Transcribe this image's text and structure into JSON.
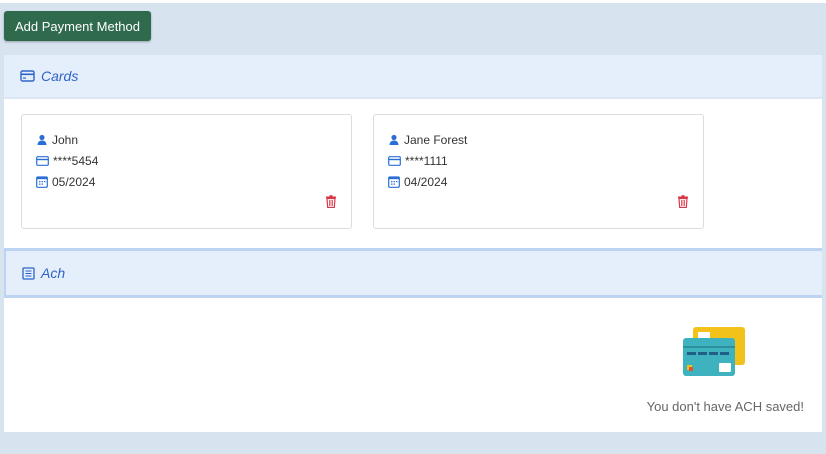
{
  "toolbar": {
    "add_label": "Add Payment Method"
  },
  "sections": {
    "cards_title": "Cards",
    "ach_title": "Ach"
  },
  "cards": [
    {
      "name": "John",
      "number": "****5454",
      "expiry": "05/2024"
    },
    {
      "name": "Jane Forest",
      "number": "****1111",
      "expiry": "04/2024"
    }
  ],
  "ach": {
    "empty_text": "You don't have ACH saved!"
  },
  "colors": {
    "accent": "#2f63c9",
    "button": "#2f6a4c",
    "delete": "#d9364a"
  }
}
